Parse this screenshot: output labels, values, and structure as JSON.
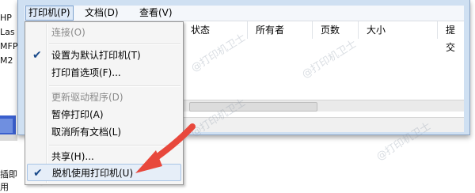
{
  "desktop_side": {
    "texts": [
      "HP",
      "Las",
      "MFP",
      "M2"
    ],
    "bottom_text": "插即用"
  },
  "menubar": {
    "items": [
      {
        "label": "打印机(P)"
      },
      {
        "label": "文档(D)"
      },
      {
        "label": "查看(V)"
      }
    ]
  },
  "list": {
    "columns": [
      "状态",
      "所有者",
      "页数",
      "大小",
      "提交"
    ]
  },
  "dropdown": {
    "items": [
      {
        "label": "连接(O)",
        "checked": false,
        "disabled": true
      },
      {
        "label": "设置为默认打印机(T)",
        "checked": true,
        "disabled": false
      },
      {
        "label": "打印首选项(F)...",
        "checked": false,
        "disabled": false
      },
      {
        "label": "更新驱动程序(D)",
        "checked": false,
        "disabled": true
      },
      {
        "label": "暂停打印(A)",
        "checked": false,
        "disabled": false
      },
      {
        "label": "取消所有文档(L)",
        "checked": false,
        "disabled": false
      },
      {
        "label": "共享(H)...",
        "checked": false,
        "disabled": false
      },
      {
        "label": "脱机使用打印机(U)",
        "checked": true,
        "disabled": false
      }
    ]
  },
  "watermark": "@打印机卫士",
  "colors": {
    "window_frame": "#cfe0f2",
    "arrow": "#e8483c",
    "highlight": "#e6eef8"
  }
}
